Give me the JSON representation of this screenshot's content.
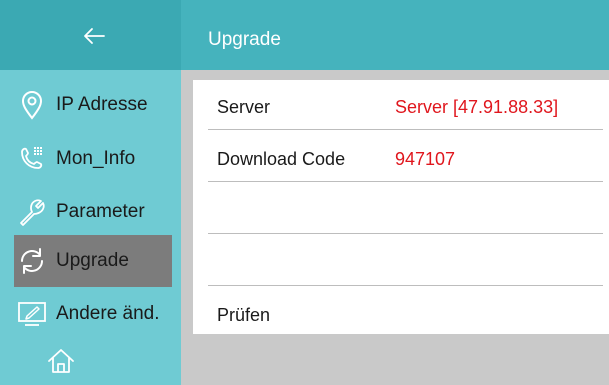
{
  "sidebar": {
    "items": [
      {
        "label": "IP Adresse",
        "icon": "location-pin-icon"
      },
      {
        "label": "Mon_Info",
        "icon": "phone-keypad-icon"
      },
      {
        "label": "Parameter",
        "icon": "wrench-icon"
      },
      {
        "label": "Upgrade",
        "icon": "refresh-icon",
        "active": true
      },
      {
        "label": "Andere änd.",
        "icon": "monitor-edit-icon"
      },
      {
        "label": "",
        "icon": "home-icon"
      }
    ]
  },
  "header": {
    "back_icon": "arrow-left-icon",
    "title": "Upgrade"
  },
  "rows": [
    {
      "label": "Server",
      "value": "Server [47.91.88.33]"
    },
    {
      "label": "Download Code",
      "value": "947107"
    },
    {
      "label": "",
      "value": ""
    },
    {
      "label": "",
      "value": ""
    },
    {
      "label": "Prüfen",
      "value": ""
    }
  ],
  "colors": {
    "sidebar_bg": "#6fcbd3",
    "sidebar_header_bg": "#3ba9b3",
    "header_bg": "#45b3bd",
    "active_item_bg": "#7c7c7c",
    "value_text": "#e0161d",
    "content_bg": "#c9c9c9"
  }
}
